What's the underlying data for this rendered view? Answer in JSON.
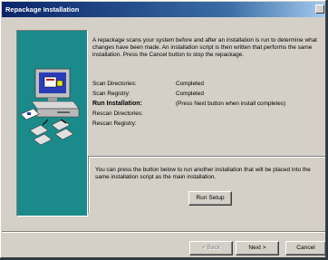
{
  "window": {
    "title": "Repackage Installation"
  },
  "intro": {
    "text": "A repackage scans your system before and after an installation is run to determine what changes have been made. An installation script is then written that performs the same installation. Press the Cancel button to stop the repackage."
  },
  "steps": [
    {
      "label": "Scan Directories:",
      "value": "Completed",
      "bold": false
    },
    {
      "label": "Scan Registry:",
      "value": "Completed",
      "bold": false
    },
    {
      "label": "Run Installation:",
      "value": "(Press Next button when install completes)",
      "bold": true
    },
    {
      "label": "Rescan Directories:",
      "value": "",
      "bold": false
    },
    {
      "label": "Rescan Registry:",
      "value": "",
      "bold": false
    }
  ],
  "run_setup": {
    "text": "You can press the button below to run another installation that will be placed into the same installation script as the main installation.",
    "button_label": "Run Setup"
  },
  "footer": {
    "back_label": "< Back",
    "next_label": "Next >",
    "cancel_label": "Cancel"
  },
  "colors": {
    "accent_panel": "#1b8a8a",
    "title_bar": "#0a246a"
  }
}
